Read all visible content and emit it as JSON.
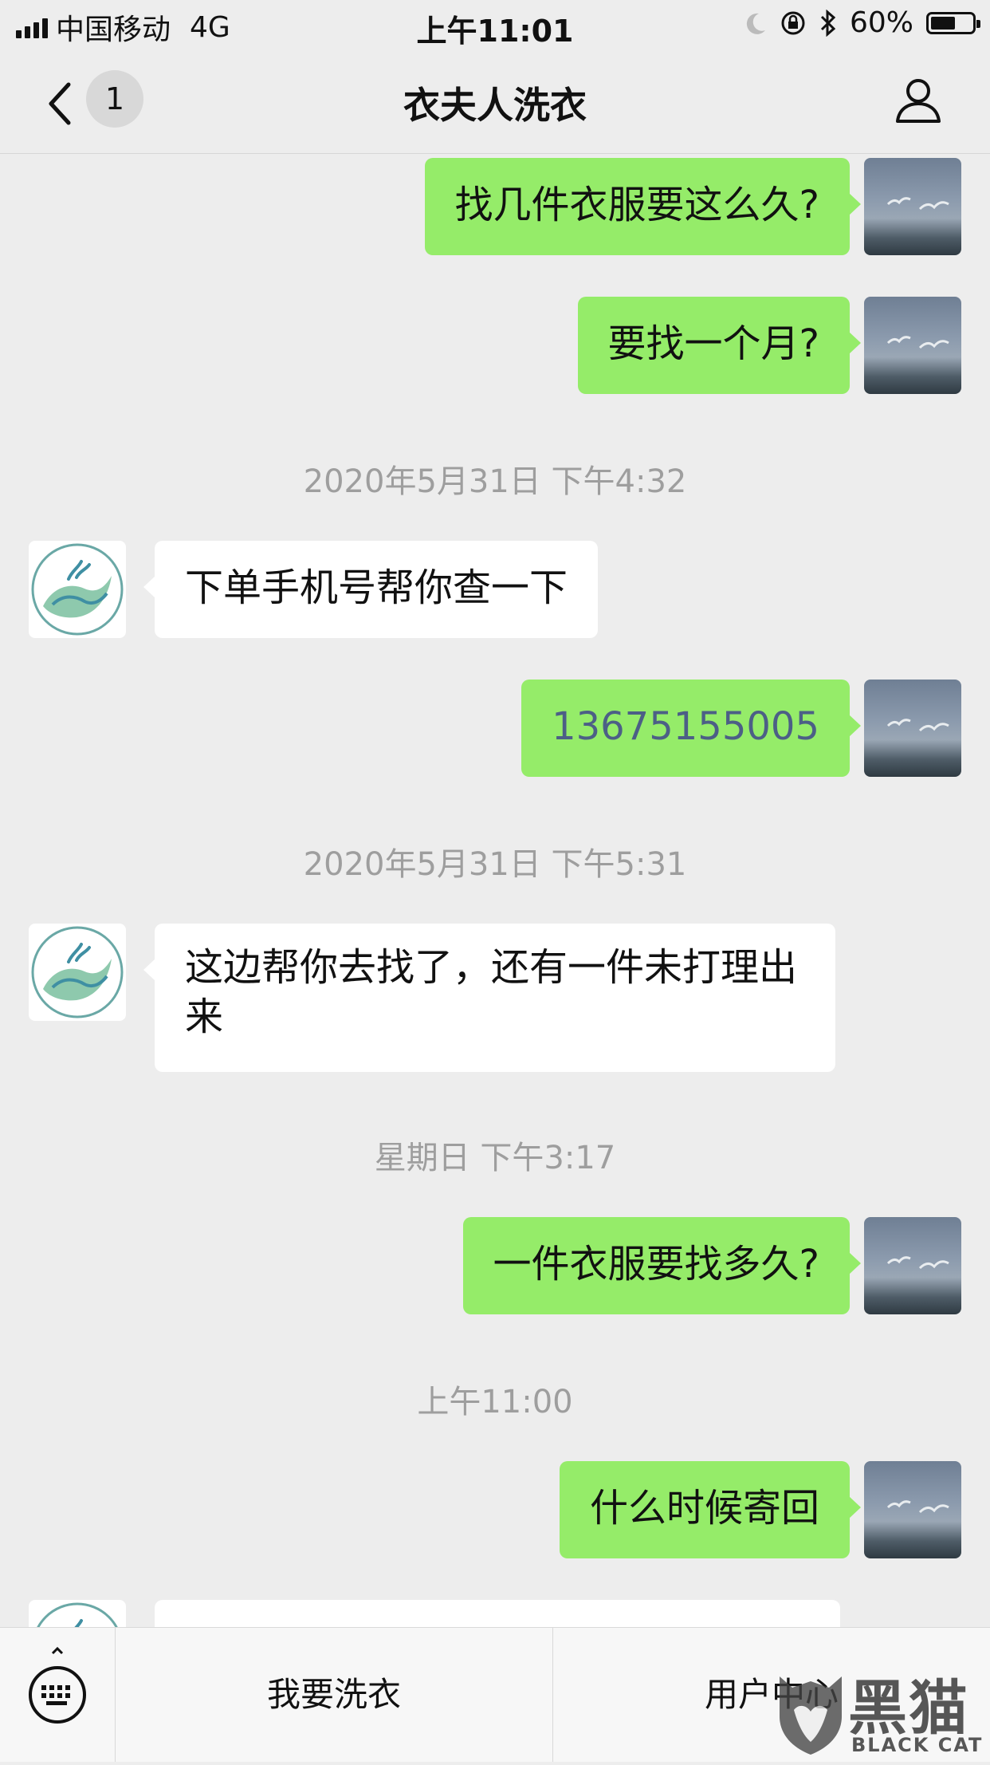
{
  "status_bar": {
    "carrier": "中国移动",
    "network": "4G",
    "time": "上午11:01",
    "battery_percent": "60%",
    "battery_level": 0.6
  },
  "nav": {
    "unread_count": "1",
    "title": "衣夫人洗衣",
    "icons": {
      "back": "chevron-left-icon",
      "profile": "person-icon"
    }
  },
  "messages": [
    {
      "type": "outgoing",
      "text": "找几件衣服要这么久?"
    },
    {
      "type": "outgoing",
      "text": "要找一个月?"
    },
    {
      "type": "timestamp",
      "text": "2020年5月31日 下午4:32"
    },
    {
      "type": "incoming",
      "text": "下单手机号帮你查一下"
    },
    {
      "type": "outgoing",
      "text": "13675155005"
    },
    {
      "type": "timestamp",
      "text": "2020年5月31日 下午5:31"
    },
    {
      "type": "incoming",
      "text": "这边帮你去找了，还有一件未打理出来"
    },
    {
      "type": "timestamp",
      "text": "星期日 下午3:17"
    },
    {
      "type": "outgoing",
      "text": "一件衣服要找多久?"
    },
    {
      "type": "timestamp",
      "text": "上午11:00"
    },
    {
      "type": "outgoing",
      "text": "什么时候寄回"
    }
  ],
  "bottom_menu": {
    "item1": "我要洗衣",
    "item2": "用户中心",
    "icons": {
      "keyboard": "keyboard-icon"
    }
  },
  "watermark": {
    "text": "黑猫",
    "subtext": "BLACK CAT"
  },
  "colors": {
    "outgoing_bubble": "#95ec69",
    "incoming_bubble": "#ffffff",
    "background": "#ededed",
    "phone_link": "#4c5f86"
  }
}
